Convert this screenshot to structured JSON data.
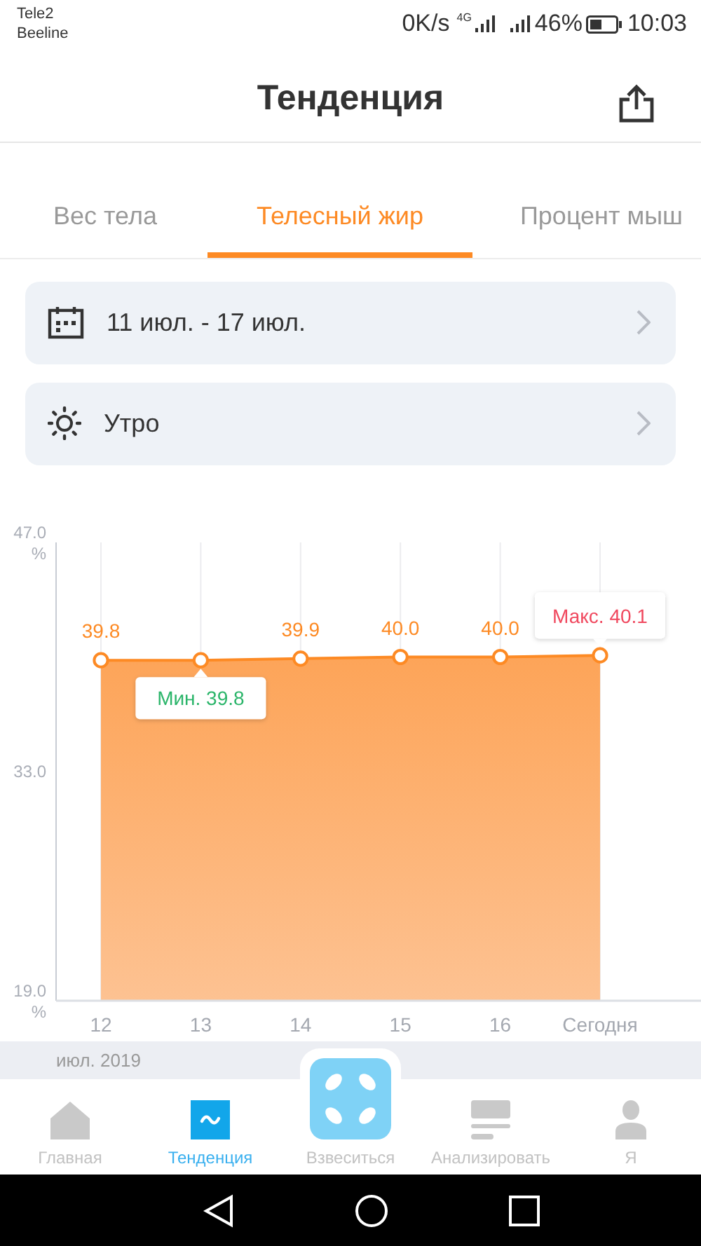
{
  "status_bar": {
    "carriers": [
      "Tele2",
      "Beeline"
    ],
    "speed": "0K/s",
    "network": "4G",
    "battery": "46%",
    "time": "10:03"
  },
  "header": {
    "title": "Тенденция"
  },
  "tabs": [
    {
      "label": "Вес тела",
      "selected": false
    },
    {
      "label": "Телесный жир",
      "selected": true
    },
    {
      "label": "Процент мыш",
      "selected": false
    }
  ],
  "date_range": "11 июл. - 17 июл.",
  "period": "Утро",
  "chart": {
    "chart_data": {
      "type": "area",
      "grid": true,
      "categories": [
        "12",
        "13",
        "14",
        "15",
        "16",
        "Сегодня"
      ],
      "series": [
        {
          "color": "#fd8a24",
          "values": [
            39.8,
            39.8,
            39.9,
            40.0,
            40.0,
            40.1
          ]
        }
      ],
      "ylim": [
        19,
        47
      ],
      "yticks": [
        {
          "value": 47,
          "label": "47.0\n%"
        },
        {
          "value": 33,
          "label": "33.0"
        },
        {
          "value": 19,
          "label": "19.0\n%"
        }
      ],
      "value_labels": [
        "39.8",
        null,
        "39.9",
        "40.0",
        "40.0",
        null
      ],
      "annotations": [
        {
          "text": "Мин. 39.8",
          "x": "13",
          "y": 39.8
        },
        {
          "text": "Макс. 40.1",
          "x": "Сегодня",
          "y": 40.1
        }
      ]
    }
  },
  "month_label": "июл. 2019",
  "bottom_nav": [
    {
      "kind": "home",
      "label": "Главная",
      "selected": false
    },
    {
      "kind": "trend",
      "label": "Тенденция",
      "selected": true
    },
    {
      "kind": "weigh",
      "label": "Взвеситься",
      "selected": false
    },
    {
      "kind": "analyze",
      "label": "Анализировать",
      "selected": false
    },
    {
      "kind": "profile",
      "label": "Я",
      "selected": false
    }
  ]
}
